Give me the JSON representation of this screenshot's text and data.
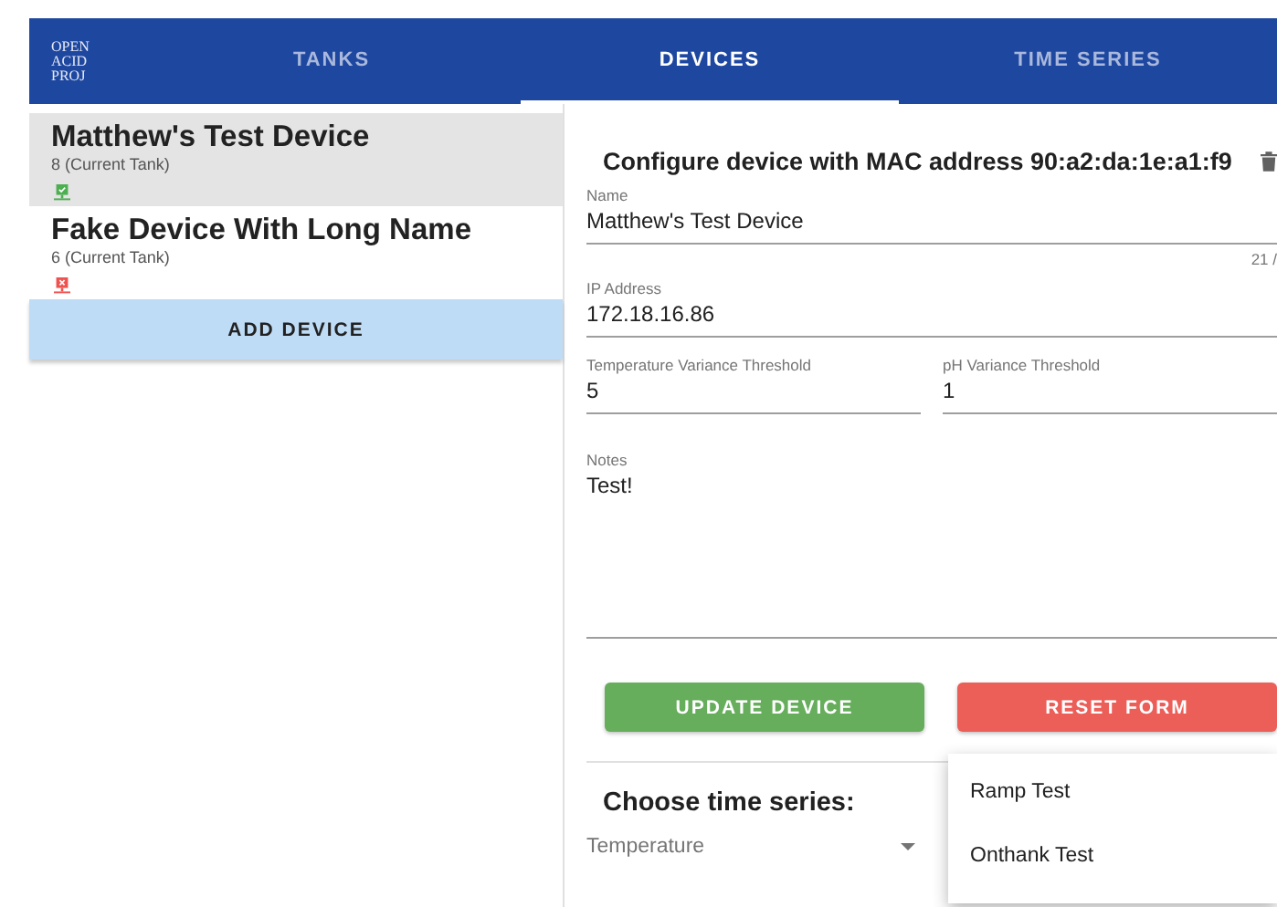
{
  "app_bar": {
    "logo_lines": [
      "OPEN",
      "ACID",
      "PROJ"
    ],
    "tabs": [
      {
        "label": "TANKS",
        "selected": false
      },
      {
        "label": "DEVICES",
        "selected": true
      },
      {
        "label": "TIME SERIES",
        "selected": false
      }
    ]
  },
  "devices": [
    {
      "name": "Matthew's Test Device",
      "tank": "8 (Current Tank)",
      "online": true,
      "selected": true
    },
    {
      "name": "Fake Device With Long Name",
      "tank": "6 (Current Tank)",
      "online": false,
      "selected": false
    }
  ],
  "add_button": "ADD DEVICE",
  "form": {
    "title": "Configure device with MAC address 90:a2:da:1e:a1:f9",
    "name": {
      "label": "Name",
      "value": "Matthew's Test Device",
      "counter": "21 /"
    },
    "ip": {
      "label": "IP Address",
      "value": "172.18.16.86"
    },
    "temp": {
      "label": "Temperature Variance Threshold",
      "value": "5"
    },
    "ph": {
      "label": "pH Variance Threshold",
      "value": "1"
    },
    "notes": {
      "label": "Notes",
      "value": "Test!"
    },
    "update_button": "UPDATE DEVICE",
    "reset_button": "RESET FORM",
    "series_heading": "Choose time series:",
    "series_value": "Temperature"
  },
  "menu": [
    "Ramp Test",
    "Onthank Test"
  ]
}
